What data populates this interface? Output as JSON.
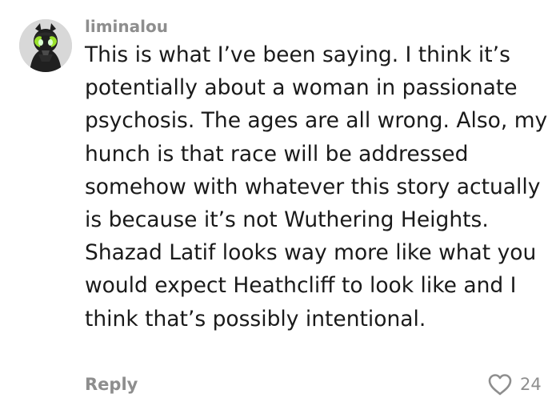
{
  "comment": {
    "username": "liminalou",
    "text": "This is what I’ve been saying. I think it’s potentially about a woman in passionate psychosis. The ages are all wrong. Also, my hunch is that race will be addressed somehow with whatever this story actually is because it’s not Wuthering Heights. Shazad Latif looks way more like what you would expect Heathcliff to look like and I think that’s possibly intentional.",
    "reply_label": "Reply",
    "like_count": "24",
    "avatar_icon": "avatar-anime-character-icon",
    "like_icon": "heart-outline-icon"
  },
  "colors": {
    "meta_gray": "#8e8e8e",
    "text": "#1a1a1a",
    "avatar_accent": "#9be22d"
  }
}
